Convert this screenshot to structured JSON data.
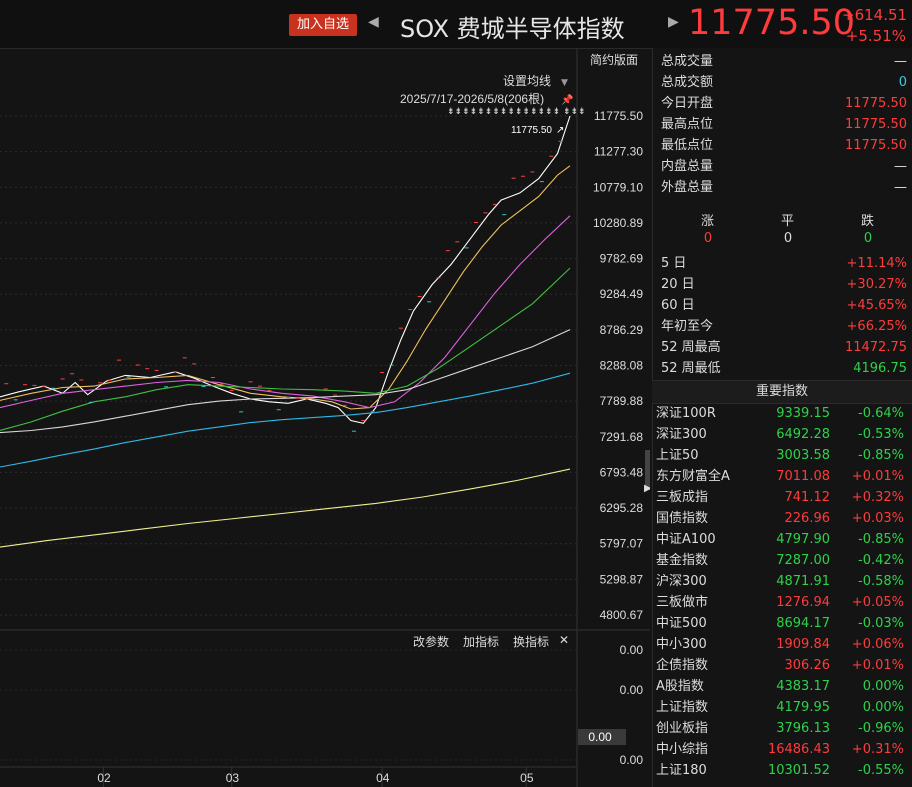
{
  "header": {
    "add_label": "加入自选",
    "title": "SOX 费城半导体指数",
    "price": "11775.50",
    "change": "+614.51",
    "change_pct": "+5.51%"
  },
  "chart_toolbar": {
    "simple_label": "简约版面",
    "ma_label": "设置均线",
    "range_label": "2025/7/17-2026/5/8(206根)",
    "last_price_label": "11775.50"
  },
  "sub_toolbar": {
    "params": "改参数",
    "add_ind": "加指标",
    "switch_ind": "换指标",
    "close": "✕"
  },
  "chart_data": {
    "type": "line",
    "title": "SOX 费城半导体指数",
    "y_ticks": [
      "11775.50",
      "11277.30",
      "10779.10",
      "10280.89",
      "9782.69",
      "9284.49",
      "8786.29",
      "8288.08",
      "7789.88",
      "7291.68",
      "6793.48",
      "6295.28",
      "5797.07",
      "5298.87",
      "4800.67"
    ],
    "ylim": [
      4800.67,
      11775.5
    ],
    "x_ticks": [
      "02",
      "03",
      "04",
      "05"
    ],
    "x_tick_at": [
      33,
      74,
      122,
      168
    ],
    "n_points": 183,
    "series": [
      {
        "color": "#ffffff",
        "x": [
          0,
          6,
          14,
          20,
          24,
          28,
          34,
          40,
          48,
          56,
          62,
          68,
          74,
          80,
          86,
          92,
          98,
          104,
          108,
          112,
          116,
          120,
          124,
          128,
          132,
          138,
          144,
          150,
          156,
          160,
          166,
          172,
          178,
          182
        ],
        "values": [
          7850,
          7920,
          8000,
          7900,
          8050,
          7880,
          8070,
          8150,
          8120,
          8200,
          8110,
          8000,
          7900,
          7820,
          7780,
          7760,
          7820,
          7760,
          7700,
          7520,
          7480,
          7700,
          8200,
          8650,
          9050,
          9420,
          9700,
          10050,
          10400,
          10600,
          10700,
          10900,
          11250,
          11775
        ]
      },
      {
        "color": "#f0c060",
        "x": [
          0,
          10,
          20,
          30,
          40,
          50,
          60,
          70,
          80,
          90,
          100,
          106,
          112,
          118,
          124,
          130,
          136,
          142,
          148,
          154,
          160,
          166,
          172,
          178,
          182
        ],
        "values": [
          7800,
          7900,
          7980,
          8000,
          8100,
          8120,
          8150,
          8020,
          7900,
          7850,
          7820,
          7780,
          7680,
          7700,
          7950,
          8350,
          8800,
          9200,
          9600,
          9950,
          10250,
          10450,
          10650,
          10950,
          11080
        ]
      },
      {
        "color": "#e060e0",
        "x": [
          0,
          10,
          20,
          30,
          40,
          50,
          60,
          70,
          80,
          90,
          100,
          110,
          118,
          126,
          134,
          142,
          150,
          158,
          166,
          174,
          182
        ],
        "values": [
          7700,
          7800,
          7900,
          7950,
          8000,
          8050,
          8080,
          8050,
          7960,
          7900,
          7860,
          7780,
          7700,
          7780,
          8050,
          8400,
          8850,
          9300,
          9700,
          10050,
          10380
        ]
      },
      {
        "color": "#40c040",
        "x": [
          0,
          10,
          20,
          30,
          40,
          50,
          60,
          70,
          80,
          90,
          100,
          110,
          120,
          130,
          140,
          150,
          160,
          170,
          182
        ],
        "values": [
          7380,
          7500,
          7650,
          7780,
          7850,
          7950,
          8020,
          8000,
          7980,
          7960,
          7950,
          7930,
          7900,
          8000,
          8250,
          8550,
          8850,
          9150,
          9650
        ]
      },
      {
        "color": "#d8d8d8",
        "x": [
          0,
          10,
          20,
          30,
          40,
          50,
          60,
          70,
          80,
          90,
          100,
          110,
          120,
          130,
          140,
          150,
          160,
          170,
          182
        ],
        "values": [
          7350,
          7380,
          7430,
          7500,
          7580,
          7660,
          7740,
          7790,
          7820,
          7830,
          7840,
          7860,
          7880,
          7950,
          8100,
          8250,
          8400,
          8550,
          8790
        ]
      },
      {
        "color": "#30b8e8",
        "x": [
          0,
          10,
          20,
          30,
          40,
          50,
          60,
          70,
          80,
          90,
          100,
          110,
          120,
          130,
          140,
          150,
          160,
          170,
          182
        ],
        "values": [
          6870,
          6950,
          7040,
          7120,
          7210,
          7290,
          7370,
          7430,
          7490,
          7530,
          7560,
          7590,
          7630,
          7700,
          7780,
          7860,
          7950,
          8040,
          8180
        ]
      },
      {
        "color": "#f0f090",
        "x": [
          0,
          15,
          30,
          45,
          60,
          75,
          90,
          105,
          120,
          135,
          150,
          165,
          182
        ],
        "values": [
          5750,
          5840,
          5920,
          6000,
          6080,
          6150,
          6220,
          6290,
          6360,
          6450,
          6560,
          6680,
          6840
        ]
      }
    ]
  },
  "sub_chart": {
    "y_ticks": [
      "0.00",
      "0.00",
      "0.00",
      "0.00"
    ],
    "highlight": "0.00"
  },
  "stats": [
    {
      "label": "总成交量",
      "value": "—",
      "color": "white"
    },
    {
      "label": "总成交额",
      "value": "0",
      "color": "cyan"
    },
    {
      "label": "今日开盘",
      "value": "11775.50",
      "color": "red"
    },
    {
      "label": "最高点位",
      "value": "11775.50",
      "color": "red"
    },
    {
      "label": "最低点位",
      "value": "11775.50",
      "color": "red"
    },
    {
      "label": "内盘总量",
      "value": "—",
      "color": "white"
    },
    {
      "label": "外盘总量",
      "value": "—",
      "color": "white"
    }
  ],
  "updown": {
    "labels": [
      "涨",
      "平",
      "跌"
    ],
    "values": [
      "0",
      "0",
      "0"
    ]
  },
  "perf": [
    {
      "label": "5 日",
      "value": "+11.14%",
      "color": "red"
    },
    {
      "label": "20 日",
      "value": "+30.27%",
      "color": "red"
    },
    {
      "label": "60 日",
      "value": "+45.65%",
      "color": "red"
    },
    {
      "label": "年初至今",
      "value": "+66.25%",
      "color": "red"
    },
    {
      "label": "52 周最高",
      "value": "11472.75",
      "color": "red"
    },
    {
      "label": "52 周最低",
      "value": "4196.75",
      "color": "green"
    }
  ],
  "indices_title": "重要指数",
  "indices": [
    {
      "name": "深证100R",
      "value": "9339.15",
      "pct": "-0.64%",
      "color": "green"
    },
    {
      "name": "深证300",
      "value": "6492.28",
      "pct": "-0.53%",
      "color": "green"
    },
    {
      "name": "上证50",
      "value": "3003.58",
      "pct": "-0.85%",
      "color": "green"
    },
    {
      "name": "东方财富全A",
      "value": "7011.08",
      "pct": "+0.01%",
      "color": "red"
    },
    {
      "name": "三板成指",
      "value": "741.12",
      "pct": "+0.32%",
      "color": "red"
    },
    {
      "name": "国债指数",
      "value": "226.96",
      "pct": "+0.03%",
      "color": "red"
    },
    {
      "name": "中证A100",
      "value": "4797.90",
      "pct": "-0.85%",
      "color": "green"
    },
    {
      "name": "基金指数",
      "value": "7287.00",
      "pct": "-0.42%",
      "color": "green"
    },
    {
      "name": "沪深300",
      "value": "4871.91",
      "pct": "-0.58%",
      "color": "green"
    },
    {
      "name": "三板做市",
      "value": "1276.94",
      "pct": "+0.05%",
      "color": "red"
    },
    {
      "name": "中证500",
      "value": "8694.17",
      "pct": "-0.03%",
      "color": "green"
    },
    {
      "name": "中小300",
      "value": "1909.84",
      "pct": "+0.06%",
      "color": "red"
    },
    {
      "name": "企债指数",
      "value": "306.26",
      "pct": "+0.01%",
      "color": "red"
    },
    {
      "name": "A股指数",
      "value": "4383.17",
      "pct": "0.00%",
      "color": "green"
    },
    {
      "name": "上证指数",
      "value": "4179.95",
      "pct": "0.00%",
      "color": "green"
    },
    {
      "name": "创业板指",
      "value": "3796.13",
      "pct": "-0.96%",
      "color": "green"
    },
    {
      "name": "中小综指",
      "value": "16486.43",
      "pct": "+0.31%",
      "color": "red"
    },
    {
      "name": "上证180",
      "value": "10301.52",
      "pct": "-0.55%",
      "color": "green"
    }
  ]
}
